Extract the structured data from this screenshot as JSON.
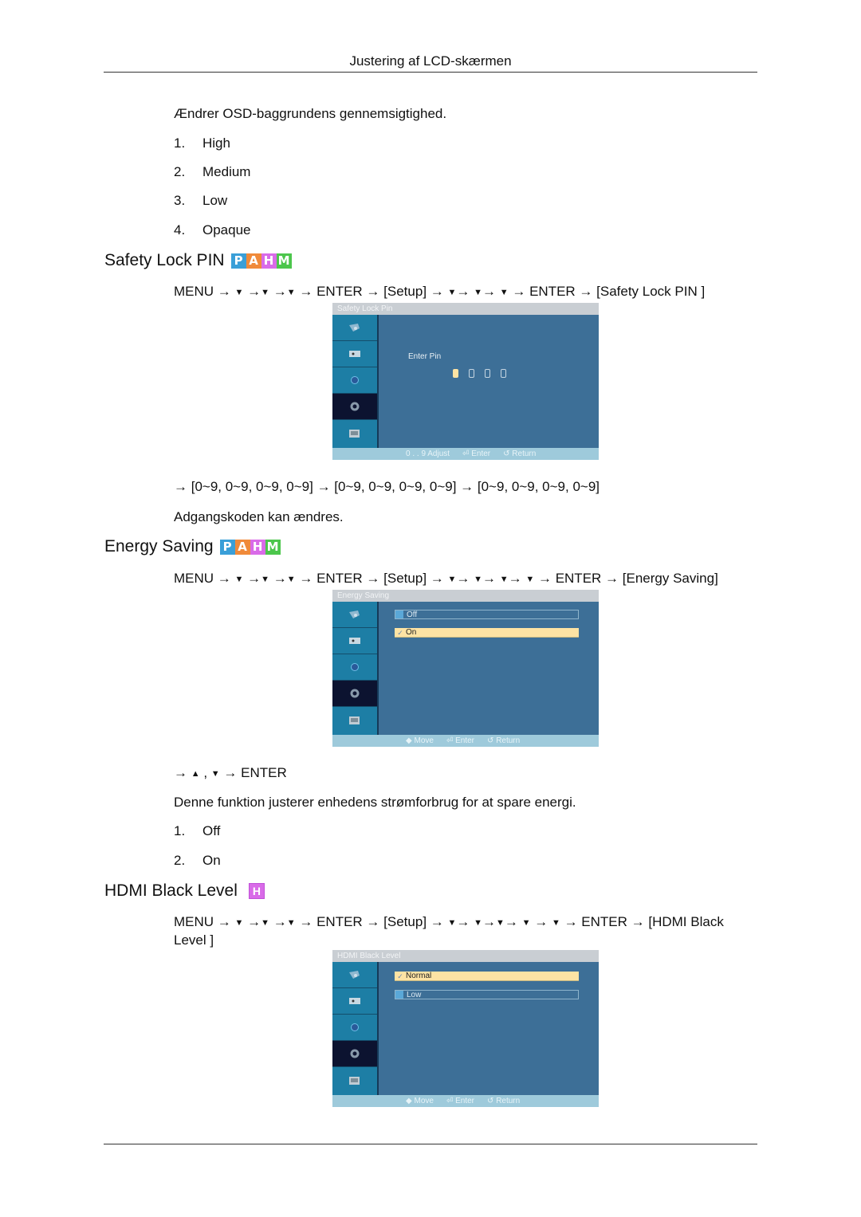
{
  "header": {
    "title": "Justering af LCD-skærmen"
  },
  "transparency": {
    "description": "Ændrer OSD-baggrundens gennemsigtighed.",
    "options": [
      {
        "num": "1.",
        "label": "High"
      },
      {
        "num": "2.",
        "label": "Medium"
      },
      {
        "num": "3.",
        "label": "Low"
      },
      {
        "num": "4.",
        "label": "Opaque"
      }
    ]
  },
  "badges": {
    "P": {
      "letter": "P",
      "color": "#3a9fd8"
    },
    "A": {
      "letter": "A",
      "color": "#f08a3a"
    },
    "H": {
      "letter": "H",
      "color": "#d96be8"
    },
    "M": {
      "letter": "M",
      "color": "#4cc64c"
    }
  },
  "safety_lock": {
    "title": "Safety Lock PIN",
    "nav": {
      "start": "MENU →",
      "mid1": "→",
      "mid2": "→",
      "enter1": "→ ENTER → [",
      "setup": "Setup",
      "after_setup": "] →",
      "seq": "→ ▼→ ▼ → ENTER → [",
      "target": "Safety Lock PIN",
      "end": " ]"
    },
    "osd": {
      "title": "Safety Lock Pin",
      "enter_pin_label": "Enter  Pin",
      "pin_digits": 4,
      "footer": {
        "adjust": "0 . . 9  Adjust",
        "enter": "Enter",
        "return": "Return"
      }
    },
    "sequence": "→ [0~9, 0~9, 0~9, 0~9] → [0~9, 0~9, 0~9, 0~9] → [0~9, 0~9, 0~9, 0~9]",
    "note": "Adgangskoden kan ændres."
  },
  "energy_saving": {
    "title": "Energy Saving",
    "nav_text_before": "MENU → ▼ →▼ →▼ → ENTER → [",
    "setup": "Setup",
    "nav_text_after": "] → ▼→ ▼→ ▼→ ▼ → ENTER → [",
    "target": "Energy Saving",
    "end": "]",
    "osd": {
      "title": "Energy Saving",
      "options": [
        {
          "label": "Off",
          "selected": false
        },
        {
          "label": "On",
          "selected": true
        }
      ],
      "footer": {
        "move": "Move",
        "enter": "Enter",
        "return": "Return"
      }
    },
    "after_nav": "→ ▲ , ▼ → ENTER",
    "description": "Denne funktion justerer enhedens strømforbrug for at spare energi.",
    "options": [
      {
        "num": "1.",
        "label": "Off"
      },
      {
        "num": "2.",
        "label": "On"
      }
    ]
  },
  "hdmi_black_level": {
    "title": "HDMI Black Level",
    "badge": "H",
    "nav_text_before": "MENU → ▼ →▼ →▼ → ENTER → [",
    "setup": "Setup",
    "nav_text_after": "] → ▼→ ▼→▼→ ▼ → ▼ → ENTER → [",
    "target_line1": "HDMI Black",
    "target_line2": "Level",
    "end": " ]",
    "osd": {
      "title": "HDMI Black Level",
      "options": [
        {
          "label": "Normal",
          "selected": true
        },
        {
          "label": "Low",
          "selected": false
        }
      ],
      "footer": {
        "move": "Move",
        "enter": "Enter",
        "return": "Return"
      }
    }
  },
  "osd_sidebar_icons": [
    "input-icon",
    "picture-icon",
    "sound-icon",
    "setup-icon",
    "multi-control-icon"
  ],
  "osd_check_mark": "✓",
  "osd_move_glyph": "◆"
}
